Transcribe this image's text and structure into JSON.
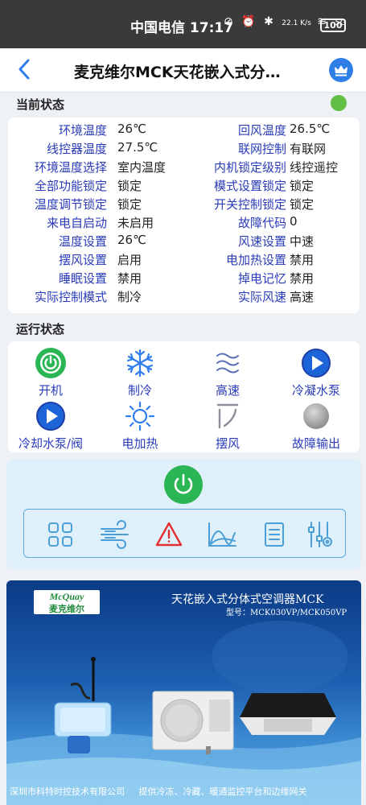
{
  "status_bar": {
    "carrier_time": "中国电信 17:17",
    "net_speed": "22.1 K/s",
    "signal": "5G",
    "battery": "100"
  },
  "header": {
    "title": "麦克维尔MCK天花嵌入式分…"
  },
  "current_status": {
    "title": "当前状态",
    "online_color": "#62bf45",
    "rows": [
      {
        "l1": "环境温度",
        "v1": "26℃",
        "l2": "回风温度",
        "v2": "26.5℃"
      },
      {
        "l1": "线控器温度",
        "v1": "27.5℃",
        "l2": "联网控制",
        "v2": "有联网"
      },
      {
        "l1": "环境温度选择",
        "v1": "室内温度",
        "l2": "内机锁定级别",
        "v2": "线控遥控"
      },
      {
        "l1": "全部功能锁定",
        "v1": "锁定",
        "l2": "模式设置锁定",
        "v2": "锁定"
      },
      {
        "l1": "温度调节锁定",
        "v1": "锁定",
        "l2": "开关控制锁定",
        "v2": "锁定"
      },
      {
        "l1": "来电自启动",
        "v1": "未启用",
        "l2": "故障代码",
        "v2": "0"
      },
      {
        "l1": "温度设置",
        "v1": "26℃",
        "l2": "风速设置",
        "v2": "中速"
      },
      {
        "l1": "摆风设置",
        "v1": "启用",
        "l2": "电加热设置",
        "v2": "禁用"
      },
      {
        "l1": "睡眠设置",
        "v1": "禁用",
        "l2": "掉电记忆",
        "v2": "禁用"
      },
      {
        "l1": "实际控制模式",
        "v1": "制冷",
        "l2": "实际风速",
        "v2": "高速"
      }
    ]
  },
  "run_status": {
    "title": "运行状态",
    "items": [
      {
        "label": "开机",
        "icon": "power-on-icon"
      },
      {
        "label": "制冷",
        "icon": "snowflake-icon"
      },
      {
        "label": "高速",
        "icon": "fan-speed-waves-icon"
      },
      {
        "label": "冷凝水泵",
        "icon": "play-circle-icon"
      },
      {
        "label": "冷却水泵/阀",
        "icon": "play-circle-icon"
      },
      {
        "label": "电加热",
        "icon": "sun-heat-icon"
      },
      {
        "label": "摆风",
        "icon": "swing-icon"
      },
      {
        "label": "故障输出",
        "icon": "fault-indicator-icon"
      }
    ]
  },
  "control_panel": {
    "power_button": "power-button-icon",
    "toolbar": [
      "grid-menu-icon",
      "wind-icon",
      "alarm-warning-icon",
      "chart-curve-icon",
      "document-list-icon",
      "settings-sliders-icon"
    ]
  },
  "banner": {
    "logo_en": "McQuay",
    "logo_cn": "麦克维尔",
    "title": "天花嵌入式分体式空调器MCK",
    "model": "型号：MCK030VP/MCK050VP",
    "footer_left": "深圳市科特时控技术有限公司",
    "footer_right": "提供冷冻、冷藏、暖通监控平台和边缘网关"
  }
}
